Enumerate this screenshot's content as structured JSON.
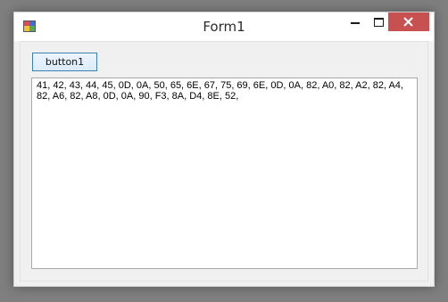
{
  "window": {
    "title": "Form1",
    "controls": {
      "minimize_icon": "minimize-icon",
      "maximize_icon": "maximize-icon",
      "close_icon": "close-icon",
      "close_color": "#c75050"
    }
  },
  "form": {
    "button1_label": "button1",
    "textbox_value": "41, 42, 43, 44, 45, 0D, 0A, 50, 65, 6E, 67, 75, 69, 6E, 0D, 0A, 82, A0, 82, A2, 82, A4,\n82, A6, 82, A8, 0D, 0A, 90, F3, 8A, D4, 8E, 52,"
  }
}
